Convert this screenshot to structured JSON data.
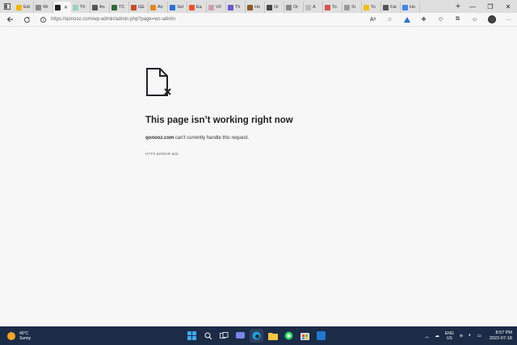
{
  "browser": {
    "tabs": [
      {
        "label": "Edi",
        "color": "#f2b600"
      },
      {
        "label": "Wi",
        "color": "#888888"
      },
      {
        "label": "",
        "color": "#222222",
        "active": true
      },
      {
        "label": "Th",
        "color": "#9ad0c2"
      },
      {
        "label": "An",
        "color": "#555555"
      },
      {
        "label": "TC",
        "color": "#2d6b3a"
      },
      {
        "label": "GE",
        "color": "#c94b2c"
      },
      {
        "label": "An",
        "color": "#e08a1e"
      },
      {
        "label": "Sel",
        "color": "#2a6fd6"
      },
      {
        "label": "Ea",
        "color": "#e8562a"
      },
      {
        "label": "VII",
        "color": "#d0a0b0"
      },
      {
        "label": "Th",
        "color": "#6a5acd"
      },
      {
        "label": "Ho",
        "color": "#8b5a2b"
      },
      {
        "label": "Or",
        "color": "#444444"
      },
      {
        "label": "Or",
        "color": "#888888"
      },
      {
        "label": "A",
        "color": "#bbbbbb"
      },
      {
        "label": "To",
        "color": "#d9534f"
      },
      {
        "label": "Si",
        "color": "#999999"
      },
      {
        "label": "To",
        "color": "#f0c000"
      },
      {
        "label": "Fal",
        "color": "#555555"
      },
      {
        "label": "Ho",
        "color": "#4285f4"
      }
    ],
    "url": "https://qonooz.com/wp-admin/admin.php?page=wc-admin"
  },
  "error": {
    "title": "This page isn’t working right now",
    "domain": "qonooz.com",
    "message": " can't currently handle this request.",
    "code": "HTTP ERROR 500"
  },
  "taskbar": {
    "temperature": "40°C",
    "condition": "Sunny",
    "lang_top": "ENG",
    "lang_bottom": "US",
    "time": "8:57 PM",
    "date": "2022-07-18"
  }
}
